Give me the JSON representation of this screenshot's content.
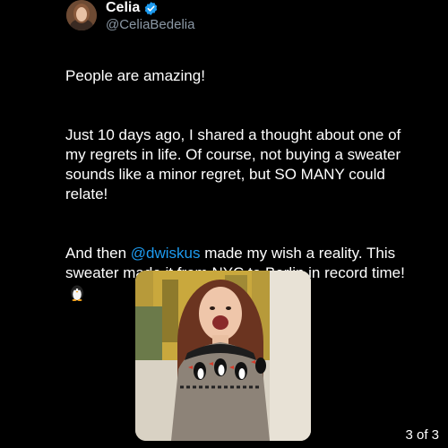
{
  "author": {
    "name": "Celia",
    "handle": "@CeliaBedelia",
    "verified_color": "#1d9bf0"
  },
  "tweet": {
    "p1": "People are amazing!",
    "p2": "Just 10 days ago, I shared a thought about one of my regrets in life. Of course, not buying a sweater sounds like a minor regret, but SO MANY could relate!",
    "p3_before": "And then ",
    "p3_mention": "@dwiskus",
    "p3_after": " made my wish a reality. This sweater made it from NYC to Berlin in record time!",
    "emoji": "penguin-emoji"
  },
  "media": {
    "icon": "photo-woman-in-puffin-sweater"
  },
  "pager": {
    "label": "3 of 3"
  },
  "colors": {
    "background": "#000000",
    "text": "#ffffff",
    "secondary": "#8b98a5",
    "link": "#1d9bf0"
  }
}
